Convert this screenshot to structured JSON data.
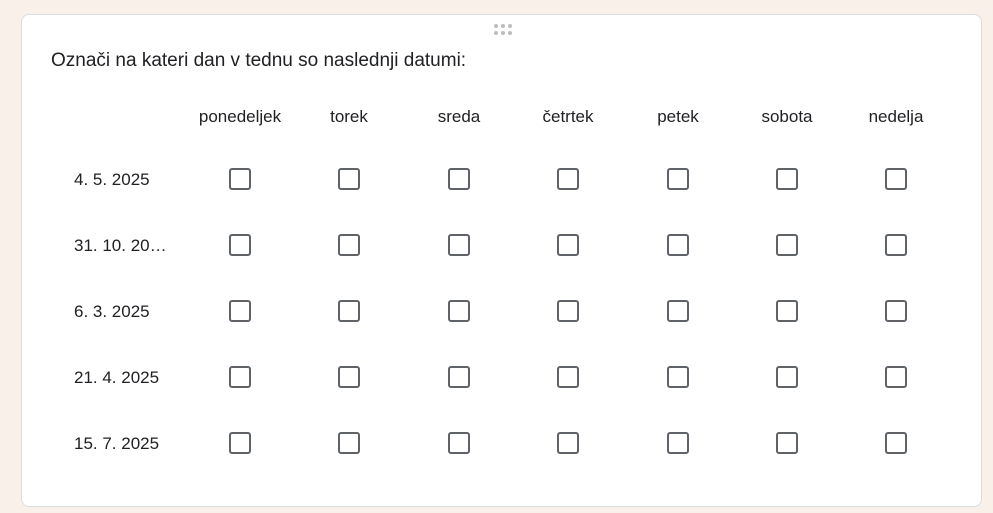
{
  "question": {
    "title": "Označi na kateri dan v tednu so naslednji datumi:"
  },
  "columns": [
    "ponedeljek",
    "torek",
    "sreda",
    "četrtek",
    "petek",
    "sobota",
    "nedelja"
  ],
  "rows": [
    "4. 5. 2025",
    "31. 10. 20…",
    "6. 3. 2025",
    "21. 4. 2025",
    "15. 7. 2025"
  ],
  "checked": [
    [
      false,
      false,
      false,
      false,
      false,
      false,
      false
    ],
    [
      false,
      false,
      false,
      false,
      false,
      false,
      false
    ],
    [
      false,
      false,
      false,
      false,
      false,
      false,
      false
    ],
    [
      false,
      false,
      false,
      false,
      false,
      false,
      false
    ],
    [
      false,
      false,
      false,
      false,
      false,
      false,
      false
    ]
  ],
  "colors": {
    "page_background": "#faf0ea",
    "card_background": "#ffffff",
    "checkbox_border": "#5f6368"
  }
}
